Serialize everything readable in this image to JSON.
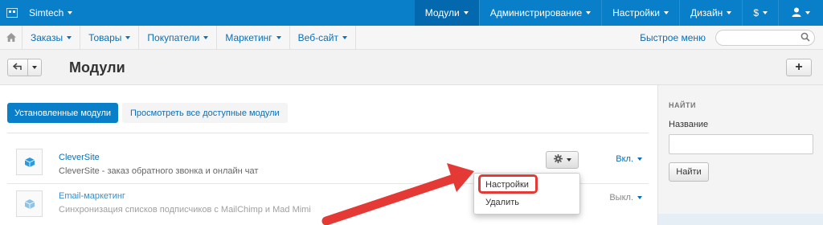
{
  "topbar": {
    "brand": "Simtech",
    "nav": [
      {
        "label": "Модули",
        "active": true
      },
      {
        "label": "Администрирование",
        "active": false
      },
      {
        "label": "Настройки",
        "active": false
      },
      {
        "label": "Дизайн",
        "active": false
      },
      {
        "label": "$",
        "active": false
      }
    ],
    "user_icon": "user-icon",
    "color": "#0a7fc9"
  },
  "subnav": {
    "items": [
      "Заказы",
      "Товары",
      "Покупатели",
      "Маркетинг",
      "Веб-сайт"
    ],
    "quick_menu": "Быстрое меню",
    "search_placeholder": ""
  },
  "titlebar": {
    "title": "Модули",
    "add_label": "+"
  },
  "tabs": {
    "installed": "Установленные модули",
    "all": "Просмотреть все доступные модули"
  },
  "modules": [
    {
      "name": "CleverSite",
      "description": "CleverSite - заказ обратного звонка и онлайн чат",
      "status": "Вкл."
    },
    {
      "name": "Email-маркетинг",
      "description": "Синхронизация списков подписчиков с MailChimp и Mad Mimi",
      "status": "Выкл."
    }
  ],
  "dropdown": {
    "settings": "Настройки",
    "delete": "Удалить"
  },
  "sidebar": {
    "heading": "НАЙТИ",
    "name_label": "Название",
    "name_value": "",
    "search_button": "Найти"
  }
}
